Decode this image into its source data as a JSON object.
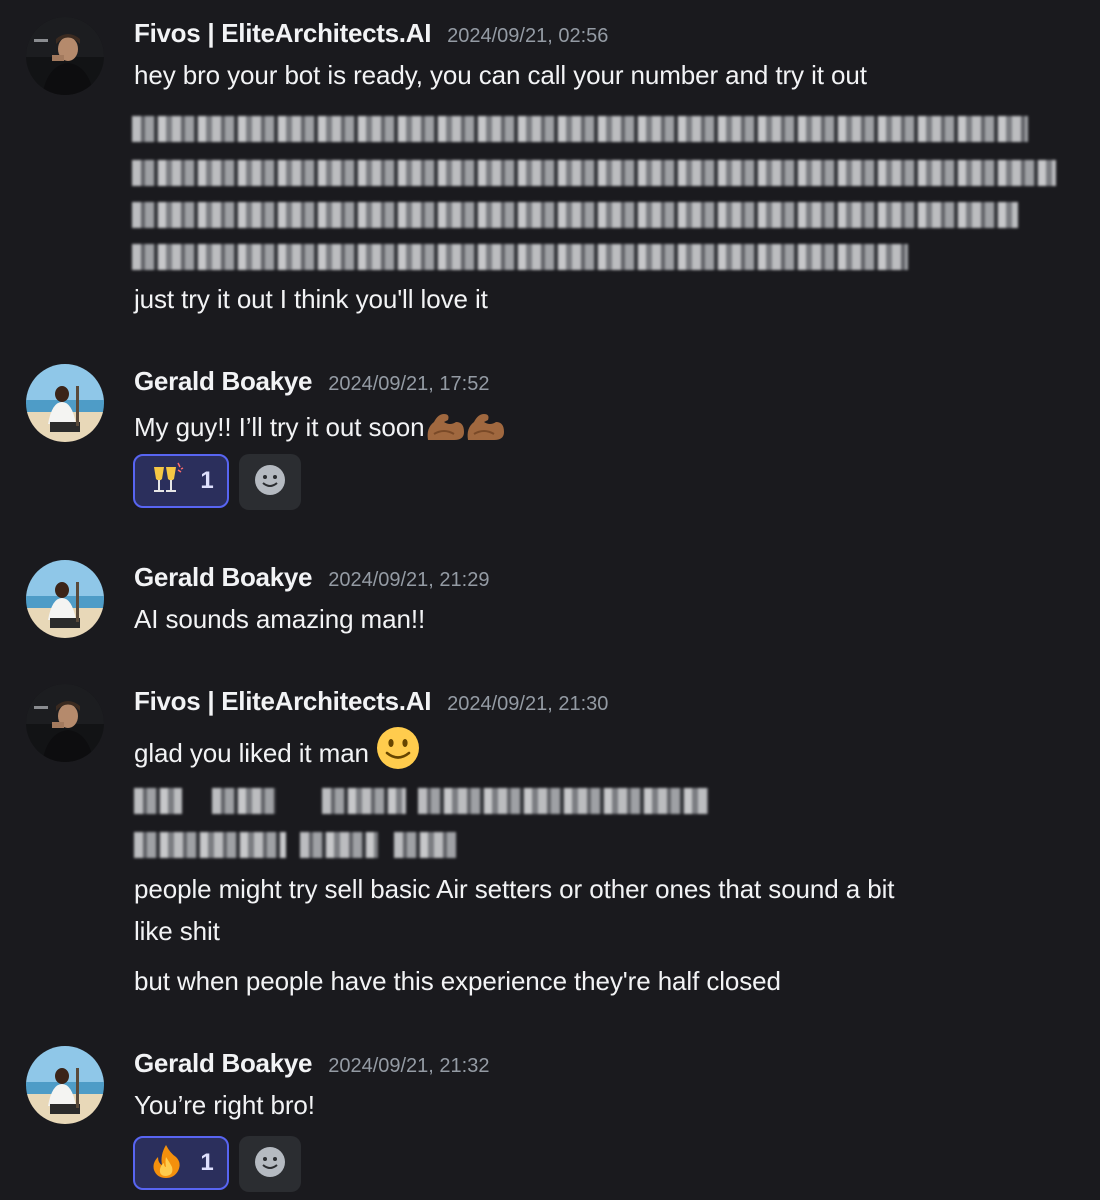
{
  "messages": [
    {
      "author": "Fivos | EliteArchitects.AI",
      "timestamp": "2024/09/21, 02:56",
      "lines": [
        "hey bro your bot is ready, you can call your number and try it out",
        "just try it out I think you'll love it"
      ]
    },
    {
      "author": "Gerald Boakye",
      "timestamp": "2024/09/21, 17:52",
      "lines": [
        "My guy!! I’ll try it out soon"
      ],
      "reaction": {
        "emoji": "clinking-glasses",
        "count": "1"
      }
    },
    {
      "author": "Gerald Boakye",
      "timestamp": "2024/09/21, 21:29",
      "lines": [
        "AI sounds amazing man!!"
      ]
    },
    {
      "author": "Fivos | EliteArchitects.AI",
      "timestamp": "2024/09/21, 21:30",
      "lines": [
        "glad you liked it man",
        "people might try sell basic Air setters or other ones that sound a bit",
        "like shit",
        "but when people have this experience they're half closed"
      ]
    },
    {
      "author": "Gerald Boakye",
      "timestamp": "2024/09/21, 21:32",
      "lines": [
        "You’re right bro!"
      ],
      "reaction": {
        "emoji": "fire",
        "count": "1"
      }
    }
  ],
  "colors": {
    "background": "#1a1a1e",
    "username": "#f2f3f5",
    "timestamp": "#949ba4",
    "reaction_border": "#5865f2",
    "reaction_bg": "#2b2f5c"
  }
}
